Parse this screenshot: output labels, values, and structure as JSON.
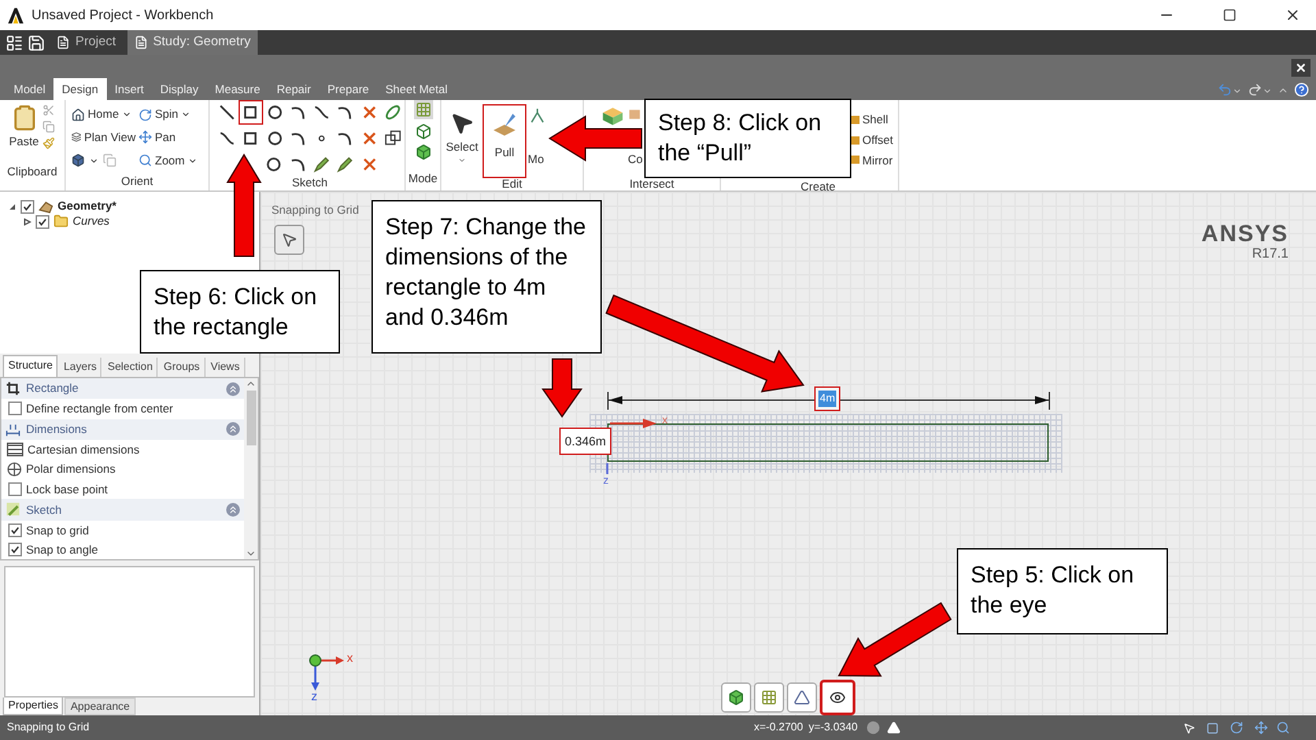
{
  "window": {
    "title": "Unsaved Project - Workbench"
  },
  "app_tabs": [
    {
      "label": "Project",
      "selected": false
    },
    {
      "label": "Study: Geometry",
      "selected": true
    }
  ],
  "ribbon_tabs": [
    {
      "label": "Model",
      "selected": false
    },
    {
      "label": "Design",
      "selected": true
    },
    {
      "label": "Insert",
      "selected": false
    },
    {
      "label": "Display",
      "selected": false
    },
    {
      "label": "Measure",
      "selected": false
    },
    {
      "label": "Repair",
      "selected": false
    },
    {
      "label": "Prepare",
      "selected": false
    },
    {
      "label": "Sheet Metal",
      "selected": false
    }
  ],
  "ribbon": {
    "clipboard": {
      "label": "Clipboard",
      "paste": "Paste"
    },
    "orient": {
      "label": "Orient",
      "home": "Home",
      "spin": "Spin",
      "plan_view": "Plan View",
      "pan": "Pan",
      "zoom": "Zoom"
    },
    "sketch": {
      "label": "Sketch"
    },
    "mode": {
      "label": "Mode"
    },
    "edit": {
      "label": "Edit",
      "select": "Select",
      "pull": "Pull",
      "move": "Mo"
    },
    "intersect": {
      "label": "Intersect",
      "combine": "Co"
    },
    "create": {
      "label": "Create",
      "tools": [
        "Shell",
        "Offset",
        "Mirror"
      ]
    }
  },
  "structure": {
    "tree": [
      {
        "label": "Geometry*",
        "checked": true,
        "expanded": true,
        "children": [
          {
            "label": "Curves",
            "checked": true,
            "expanded": false
          }
        ]
      }
    ]
  },
  "panel_tabs": [
    {
      "label": "Structure",
      "selected": true
    },
    {
      "label": "Layers",
      "selected": false
    },
    {
      "label": "Selection",
      "selected": false
    },
    {
      "label": "Groups",
      "selected": false
    },
    {
      "label": "Views",
      "selected": false
    }
  ],
  "options": [
    {
      "kind": "section",
      "label": "Rectangle"
    },
    {
      "kind": "checkbox",
      "label": "Define rectangle from center",
      "checked": false
    },
    {
      "kind": "section",
      "label": "Dimensions"
    },
    {
      "kind": "cartesian",
      "label": "Cartesian dimensions"
    },
    {
      "kind": "polar",
      "label": "Polar dimensions"
    },
    {
      "kind": "checkbox",
      "label": "Lock base point",
      "checked": false
    },
    {
      "kind": "section",
      "label": "Sketch"
    },
    {
      "kind": "checkbox",
      "label": "Snap to grid",
      "checked": true
    },
    {
      "kind": "checkbox",
      "label": "Snap to angle",
      "checked": true
    }
  ],
  "property_tabs": [
    {
      "label": "Properties",
      "selected": true
    },
    {
      "label": "Appearance",
      "selected": false
    }
  ],
  "canvas": {
    "mode_label": "Snapping to Grid",
    "brand": "ANSYS",
    "version": "R17.1",
    "height_field": "0.346m",
    "width_field": "4m",
    "axis_x": "x",
    "axis_z": "z",
    "triad_x": "x",
    "triad_z": "z"
  },
  "status_bar": {
    "message": "Snapping to Grid",
    "x": "x=-0.2700",
    "y": "y=-3.0340"
  },
  "callouts": [
    {
      "text": "Step 8: Click on the “Pull”"
    },
    {
      "text": "Step 7: Change the dimensions of the rectangle to 4m and 0.346m"
    },
    {
      "text": "Step 6: Click on the rectangle"
    },
    {
      "text": "Step 5: Click on the eye"
    }
  ]
}
